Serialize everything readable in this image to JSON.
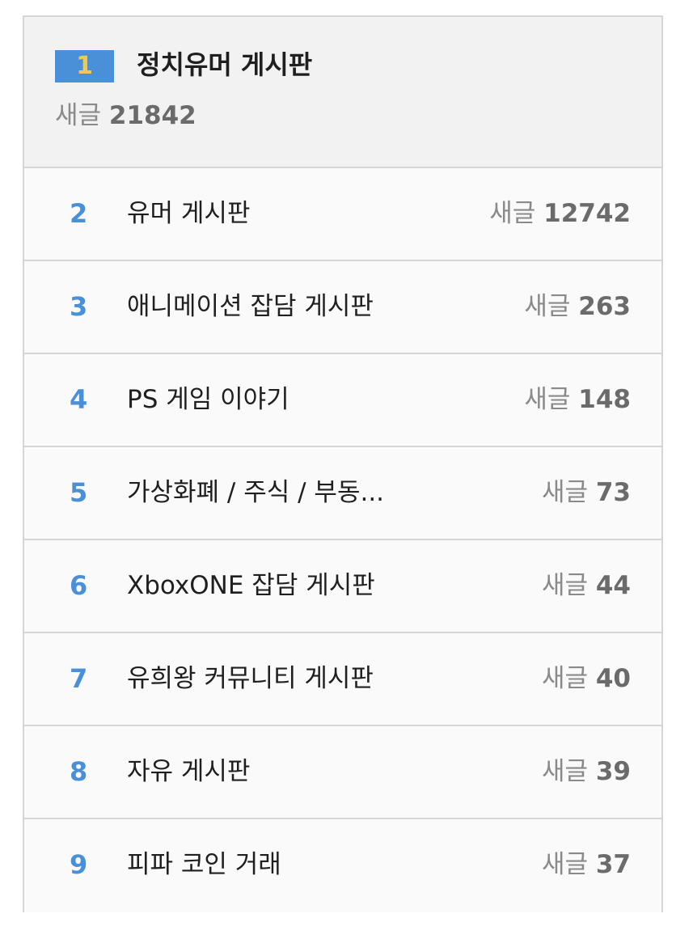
{
  "ranking": {
    "top": {
      "rank": "1",
      "title": "정치유머 게시판",
      "post_label": "새글",
      "post_count": "21842"
    },
    "items": [
      {
        "rank": "2",
        "title": "유머 게시판",
        "post_label": "새글",
        "post_count": "12742"
      },
      {
        "rank": "3",
        "title": "애니메이션 잡담 게시판",
        "post_label": "새글",
        "post_count": "263"
      },
      {
        "rank": "4",
        "title": "PS 게임 이야기",
        "post_label": "새글",
        "post_count": "148"
      },
      {
        "rank": "5",
        "title": "가상화폐 / 주식 / 부동...",
        "post_label": "새글",
        "post_count": "73"
      },
      {
        "rank": "6",
        "title": "XboxONE 잡담 게시판",
        "post_label": "새글",
        "post_count": "44"
      },
      {
        "rank": "7",
        "title": "유희왕 커뮤니티 게시판",
        "post_label": "새글",
        "post_count": "40"
      },
      {
        "rank": "8",
        "title": "자유 게시판",
        "post_label": "새글",
        "post_count": "39"
      },
      {
        "rank": "9",
        "title": "피파 코인 거래",
        "post_label": "새글",
        "post_count": "37"
      }
    ]
  },
  "colors": {
    "rank_text": "#4a90d9",
    "top_rank_bg": "#4a90d9",
    "top_rank_text": "#f2c94c",
    "border": "#d6d6d6"
  }
}
